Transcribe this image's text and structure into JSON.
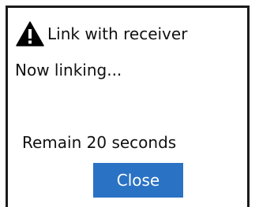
{
  "dialog": {
    "title": "Link with receiver",
    "title_icon": "warning-icon",
    "status": "Now linking...",
    "remain": "Remain 20 seconds",
    "close_label": "Close"
  },
  "colors": {
    "button_bg": "#2a72c4",
    "button_text": "#ffffff",
    "border": "#1a1a1a"
  }
}
